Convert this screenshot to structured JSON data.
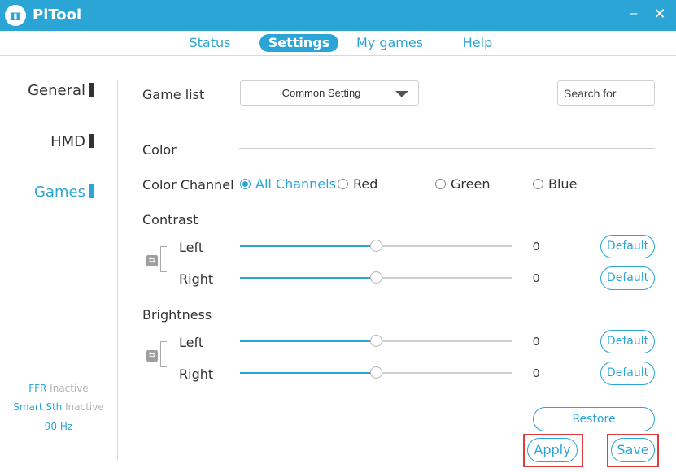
{
  "app": {
    "title": "PiTool",
    "logo_glyph": "π",
    "minimize_glyph": "–",
    "close_glyph": "✕"
  },
  "colors": {
    "accent": "#2aa5d5",
    "highlight": "#e03a3a"
  },
  "tabs": [
    {
      "label": "Status",
      "active": false
    },
    {
      "label": "Settings",
      "active": true
    },
    {
      "label": "My games",
      "active": false
    },
    {
      "label": "Help",
      "active": false
    }
  ],
  "sidebar": {
    "items": [
      {
        "label": "General",
        "active": false
      },
      {
        "label": "HMD",
        "active": false
      },
      {
        "label": "Games",
        "active": true
      }
    ],
    "status": [
      {
        "key": "FFR",
        "value": "Inactive"
      },
      {
        "key": "Smart Sth",
        "value": "Inactive"
      },
      {
        "key": "90 Hz",
        "value": ""
      }
    ]
  },
  "main": {
    "game_list_label": "Game list",
    "game_list_selected": "Common Setting",
    "search_placeholder": "Search for",
    "color_label": "Color",
    "color_channel_label": "Color Channel",
    "channels": [
      {
        "label": "All Channels",
        "selected": true
      },
      {
        "label": "Red",
        "selected": false
      },
      {
        "label": "Green",
        "selected": false
      },
      {
        "label": "Blue",
        "selected": false
      }
    ],
    "contrast": {
      "label": "Contrast",
      "left_label": "Left",
      "left_value": "0",
      "left_level": 0.5,
      "right_label": "Right",
      "right_value": "0",
      "right_level": 0.5
    },
    "brightness": {
      "label": "Brightness",
      "left_label": "Left",
      "left_value": "0",
      "left_level": 0.5,
      "right_label": "Right",
      "right_value": "0",
      "right_level": 0.5
    },
    "default_label": "Default",
    "restore_label": "Restore",
    "apply_label": "Apply",
    "save_label": "Save",
    "link_icon": "link-icon"
  }
}
